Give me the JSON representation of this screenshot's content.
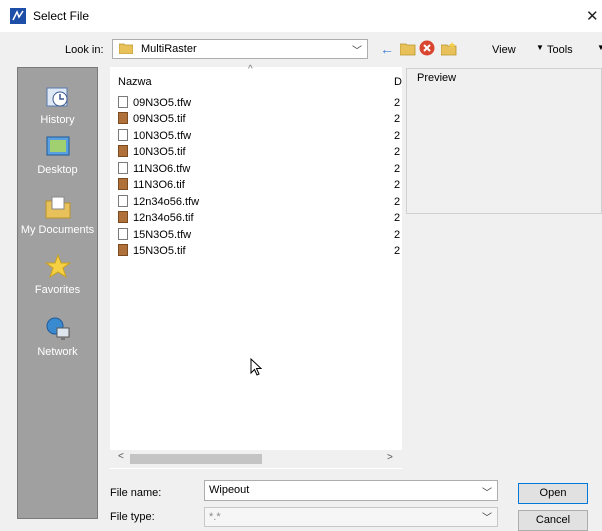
{
  "window": {
    "title": "Select File"
  },
  "lookin": {
    "label": "Look in:",
    "value": "MultiRaster"
  },
  "toolbar": {
    "view_label": "View",
    "tools_label": "Tools"
  },
  "places": [
    {
      "label": "History",
      "icon": "history-icon"
    },
    {
      "label": "Desktop",
      "icon": "desktop-icon"
    },
    {
      "label": "My Documents",
      "icon": "my-documents-icon"
    },
    {
      "label": "Favorites",
      "icon": "favorites-icon"
    },
    {
      "label": "Network",
      "icon": "network-icon"
    }
  ],
  "filelist": {
    "columns": {
      "name": "Nazwa",
      "date": "D"
    },
    "files": [
      {
        "name": "09N3O5.tfw",
        "type": "tfw",
        "date": "2"
      },
      {
        "name": "09N3O5.tif",
        "type": "tif",
        "date": "2"
      },
      {
        "name": "10N3O5.tfw",
        "type": "tfw",
        "date": "2"
      },
      {
        "name": "10N3O5.tif",
        "type": "tif",
        "date": "2"
      },
      {
        "name": "11N3O6.tfw",
        "type": "tfw",
        "date": "2"
      },
      {
        "name": "11N3O6.tif",
        "type": "tif",
        "date": "2"
      },
      {
        "name": "12n34o56.tfw",
        "type": "tfw",
        "date": "2"
      },
      {
        "name": "12n34o56.tif",
        "type": "tif",
        "date": "2"
      },
      {
        "name": "15N3O5.tfw",
        "type": "tfw",
        "date": "2"
      },
      {
        "name": "15N3O5.tif",
        "type": "tif",
        "date": "2"
      }
    ]
  },
  "preview": {
    "label": "Preview"
  },
  "filename": {
    "label": "File name:",
    "value": "Wipeout"
  },
  "filetype": {
    "label": "File type:",
    "value": "*.*"
  },
  "buttons": {
    "open": "Open",
    "cancel": "Cancel"
  }
}
